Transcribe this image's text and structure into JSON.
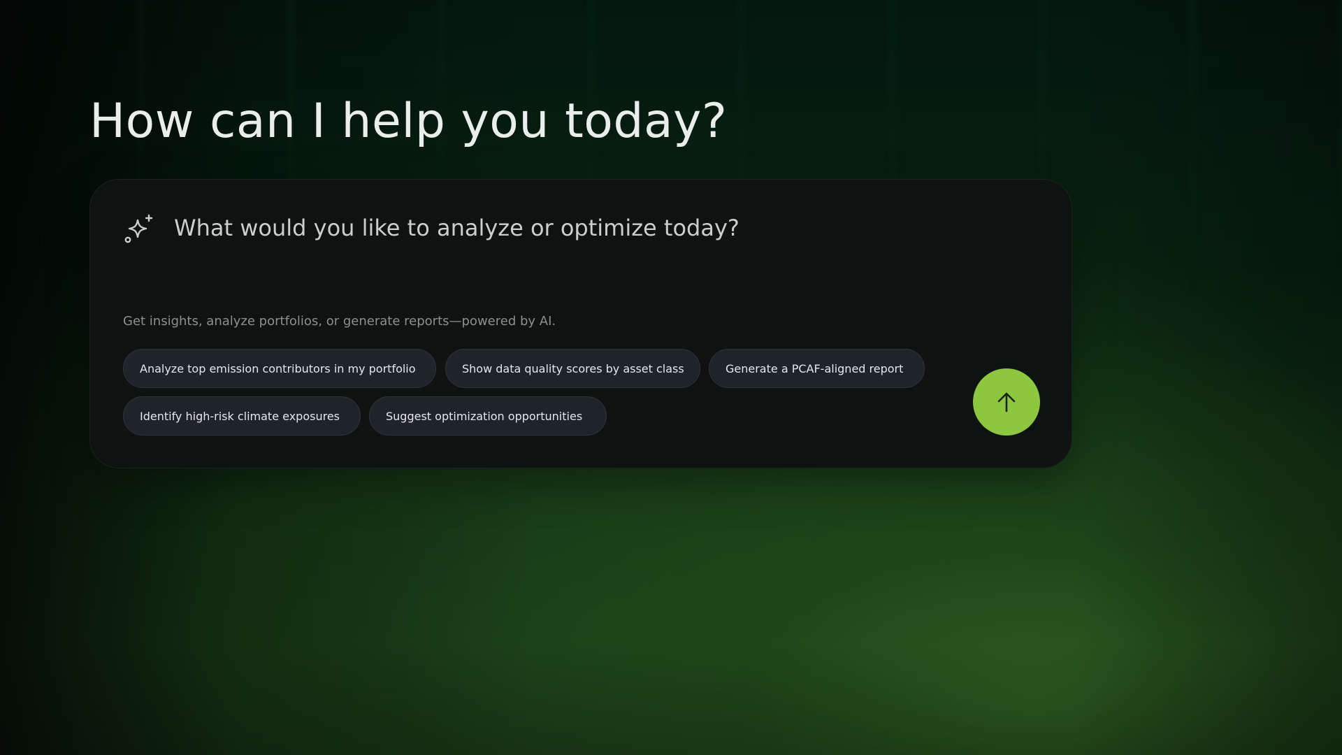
{
  "header": {
    "title": "How can I help you today?"
  },
  "assistant": {
    "prompt_placeholder": "What would you like to analyze or optimize today?",
    "helper_text": "Get insights, analyze portfolios, or generate reports—powered by AI.",
    "suggestions": [
      {
        "label": "Analyze top emission contributors in my portfolio"
      },
      {
        "label": "Show data quality scores by asset class"
      },
      {
        "label": "Generate a PCAF-aligned report"
      },
      {
        "label": "Identify high-risk climate exposures"
      },
      {
        "label": "Suggest optimization opportunities"
      }
    ],
    "prompt_icon": "sparkle-icon",
    "send_icon": "arrow-up-icon"
  },
  "colors": {
    "accent": "#8dc63f",
    "card_background": "#0e1311",
    "chip_background": "#1f232a",
    "page_gradient_dark": "#051c11",
    "page_gradient_light": "#2b5a22"
  }
}
